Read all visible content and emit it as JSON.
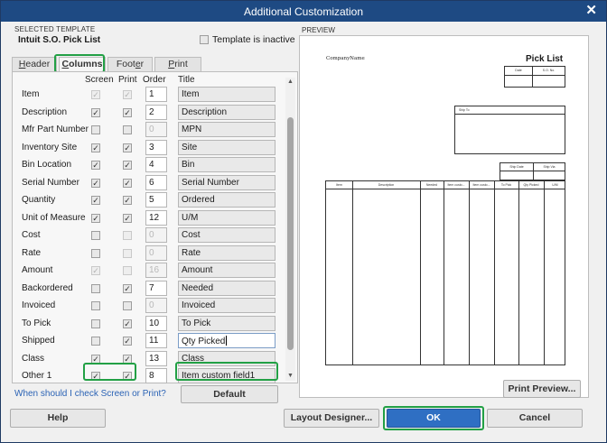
{
  "window": {
    "title": "Additional Customization",
    "close_glyph": "✕"
  },
  "template": {
    "section_label": "SELECTED TEMPLATE",
    "name": "Intuit S.O. Pick List",
    "inactive_label": "Template is inactive",
    "inactive_checked": false
  },
  "tabs": [
    {
      "label_pre": "",
      "label_u": "H",
      "label_post": "eader",
      "active": false
    },
    {
      "label_pre": "",
      "label_u": "C",
      "label_post": "olumns",
      "active": true
    },
    {
      "label_pre": "Foot",
      "label_u": "e",
      "label_post": "r",
      "active": false
    },
    {
      "label_pre": "",
      "label_u": "P",
      "label_post": "rint",
      "active": false
    }
  ],
  "columns_header": {
    "screen": "Screen",
    "print": "Print",
    "order": "Order",
    "title": "Title"
  },
  "rows": [
    {
      "label": "Item",
      "screen": true,
      "screen_enabled": false,
      "print": true,
      "print_enabled": false,
      "order": "1",
      "order_enabled": true,
      "title": "Item"
    },
    {
      "label": "Description",
      "screen": true,
      "screen_enabled": true,
      "print": true,
      "print_enabled": true,
      "order": "2",
      "order_enabled": true,
      "title": "Description"
    },
    {
      "label": "Mfr Part Number",
      "screen": false,
      "screen_enabled": true,
      "print": false,
      "print_enabled": true,
      "order": "0",
      "order_enabled": false,
      "title": "MPN"
    },
    {
      "label": "Inventory Site",
      "screen": true,
      "screen_enabled": true,
      "print": true,
      "print_enabled": true,
      "order": "3",
      "order_enabled": true,
      "title": "Site"
    },
    {
      "label": "Bin Location",
      "screen": true,
      "screen_enabled": true,
      "print": true,
      "print_enabled": true,
      "order": "4",
      "order_enabled": true,
      "title": "Bin"
    },
    {
      "label": "Serial Number",
      "screen": true,
      "screen_enabled": true,
      "print": true,
      "print_enabled": true,
      "order": "6",
      "order_enabled": true,
      "title": "Serial Number"
    },
    {
      "label": "Quantity",
      "screen": true,
      "screen_enabled": true,
      "print": true,
      "print_enabled": true,
      "order": "5",
      "order_enabled": true,
      "title": "Ordered"
    },
    {
      "label": "Unit of Measure",
      "screen": true,
      "screen_enabled": true,
      "print": true,
      "print_enabled": true,
      "order": "12",
      "order_enabled": true,
      "title": "U/M"
    },
    {
      "label": "Cost",
      "screen": false,
      "screen_enabled": true,
      "print": false,
      "print_enabled": false,
      "order": "0",
      "order_enabled": false,
      "title": "Cost"
    },
    {
      "label": "Rate",
      "screen": false,
      "screen_enabled": true,
      "print": false,
      "print_enabled": false,
      "order": "0",
      "order_enabled": false,
      "title": "Rate"
    },
    {
      "label": "Amount",
      "screen": true,
      "screen_enabled": false,
      "print": false,
      "print_enabled": false,
      "order": "16",
      "order_enabled": false,
      "title": "Amount"
    },
    {
      "label": "Backordered",
      "screen": false,
      "screen_enabled": true,
      "print": true,
      "print_enabled": true,
      "order": "7",
      "order_enabled": true,
      "title": "Needed"
    },
    {
      "label": "Invoiced",
      "screen": false,
      "screen_enabled": true,
      "print": false,
      "print_enabled": true,
      "order": "0",
      "order_enabled": false,
      "title": "Invoiced"
    },
    {
      "label": "To Pick",
      "screen": false,
      "screen_enabled": true,
      "print": true,
      "print_enabled": true,
      "order": "10",
      "order_enabled": true,
      "title": "To Pick"
    },
    {
      "label": "Shipped",
      "screen": false,
      "screen_enabled": true,
      "print": true,
      "print_enabled": true,
      "order": "11",
      "order_enabled": true,
      "title": "Qty Picked"
    },
    {
      "label": "Class",
      "screen": true,
      "screen_enabled": true,
      "print": true,
      "print_enabled": true,
      "order": "13",
      "order_enabled": true,
      "title": "Class"
    },
    {
      "label": "Other 1",
      "screen": true,
      "screen_enabled": true,
      "print": true,
      "print_enabled": true,
      "order": "8",
      "order_enabled": true,
      "title": "Item custom field1"
    }
  ],
  "help_link": "When should I check Screen or Print?",
  "buttons": {
    "default": "Default",
    "print_preview": "Print Preview...",
    "help": "Help",
    "layout_designer": "Layout Designer...",
    "ok": "OK",
    "cancel": "Cancel"
  },
  "preview": {
    "label": "PREVIEW",
    "company": "CompanyName",
    "doc_title": "Pick List",
    "date_label": "Date",
    "so_label": "S.O. No.",
    "ship_to_label": "Ship To",
    "ship_date_label": "Ship Date",
    "ship_via_label": "Ship Via",
    "table_cols": [
      "Item",
      "Description",
      "Needed",
      "Item custo...",
      "Item custo...",
      "To Pick",
      "Qty Picked",
      "U/M"
    ]
  },
  "colors": {
    "titlebar": "#1e4a83",
    "highlight": "#22a045",
    "ok_button": "#2f6fc3",
    "link": "#2b63b5"
  }
}
